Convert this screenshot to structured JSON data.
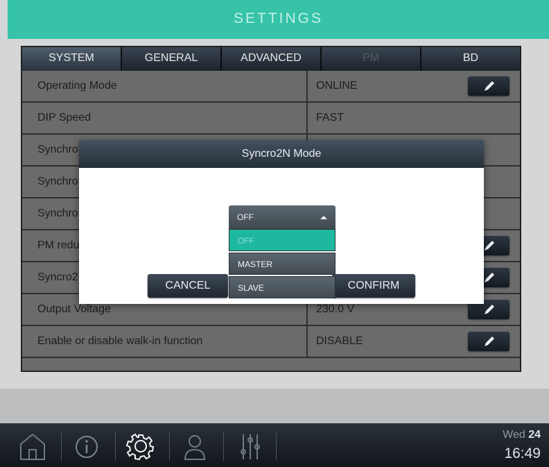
{
  "header": {
    "title": "SETTINGS"
  },
  "tabs": [
    {
      "label": "SYSTEM"
    },
    {
      "label": "GENERAL"
    },
    {
      "label": "ADVANCED"
    },
    {
      "label": "PM"
    },
    {
      "label": "BD"
    }
  ],
  "rows": [
    {
      "name": "Operating Mode",
      "value": "ONLINE"
    },
    {
      "name": "DIP Speed",
      "value": "FAST"
    },
    {
      "name": "Synchro",
      "value": ""
    },
    {
      "name": "Synchro",
      "value": ""
    },
    {
      "name": "Synchro",
      "value": ""
    },
    {
      "name": "PM redu",
      "value": ""
    },
    {
      "name": "Syncro2",
      "value": ""
    },
    {
      "name": "Output Voltage",
      "value": "230.0 V"
    },
    {
      "name": "Enable or disable walk-in function",
      "value": "DISABLE"
    }
  ],
  "dialog": {
    "title": "Syncro2N Mode",
    "selected": "OFF",
    "options": [
      "OFF",
      "MASTER",
      "SLAVE"
    ],
    "cancel_label": "CANCEL",
    "confirm_label": "CONFIRM"
  },
  "footer": {
    "day": "Wed",
    "date": "24",
    "time": "16:49"
  },
  "colors": {
    "accent": "#36c3a9",
    "highlight": "#1eb7a0"
  }
}
